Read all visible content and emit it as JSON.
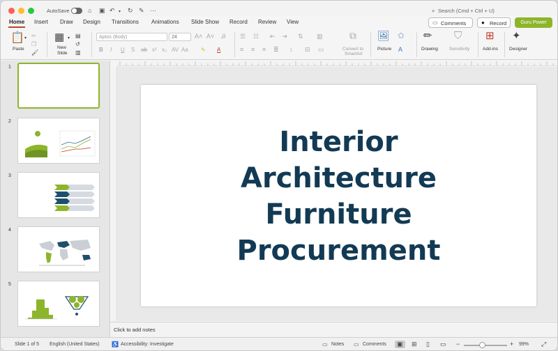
{
  "titlebar": {
    "autosave_label": "AutoSave",
    "search_placeholder": "Search (Cmd + Ctrl + U)"
  },
  "tabs": [
    "Home",
    "Insert",
    "Draw",
    "Design",
    "Transitions",
    "Animations",
    "Slide Show",
    "Record",
    "Review",
    "View"
  ],
  "header_buttons": {
    "comments": "Comments",
    "record": "Record",
    "guru": "Guru Power"
  },
  "ribbon": {
    "paste": "Paste",
    "new_slide_1": "New",
    "new_slide_2": "Slide",
    "font_name": "Aptos (Body)",
    "font_size": "24",
    "convert_1": "Convert to",
    "convert_2": "SmartArt",
    "picture": "Picture",
    "drawing": "Drawing",
    "sensitivity": "Sensitivity",
    "addins": "Add-ins",
    "designer": "Designer"
  },
  "thumbnails": [
    "1",
    "2",
    "3",
    "4",
    "5"
  ],
  "slide": {
    "title_lines": [
      "Interior",
      "Architecture",
      "Furniture",
      "Procurement"
    ]
  },
  "notes_placeholder": "Click to add notes",
  "status": {
    "slide_count": "Slide 1 of 5",
    "language": "English (United States)",
    "accessibility": "Accessibility: Investigate",
    "notes": "Notes",
    "comments": "Comments",
    "zoom": "99%"
  },
  "colors": {
    "accent_green": "#8db52b",
    "title_navy": "#133a54",
    "tab_underline": "#b7472a"
  }
}
